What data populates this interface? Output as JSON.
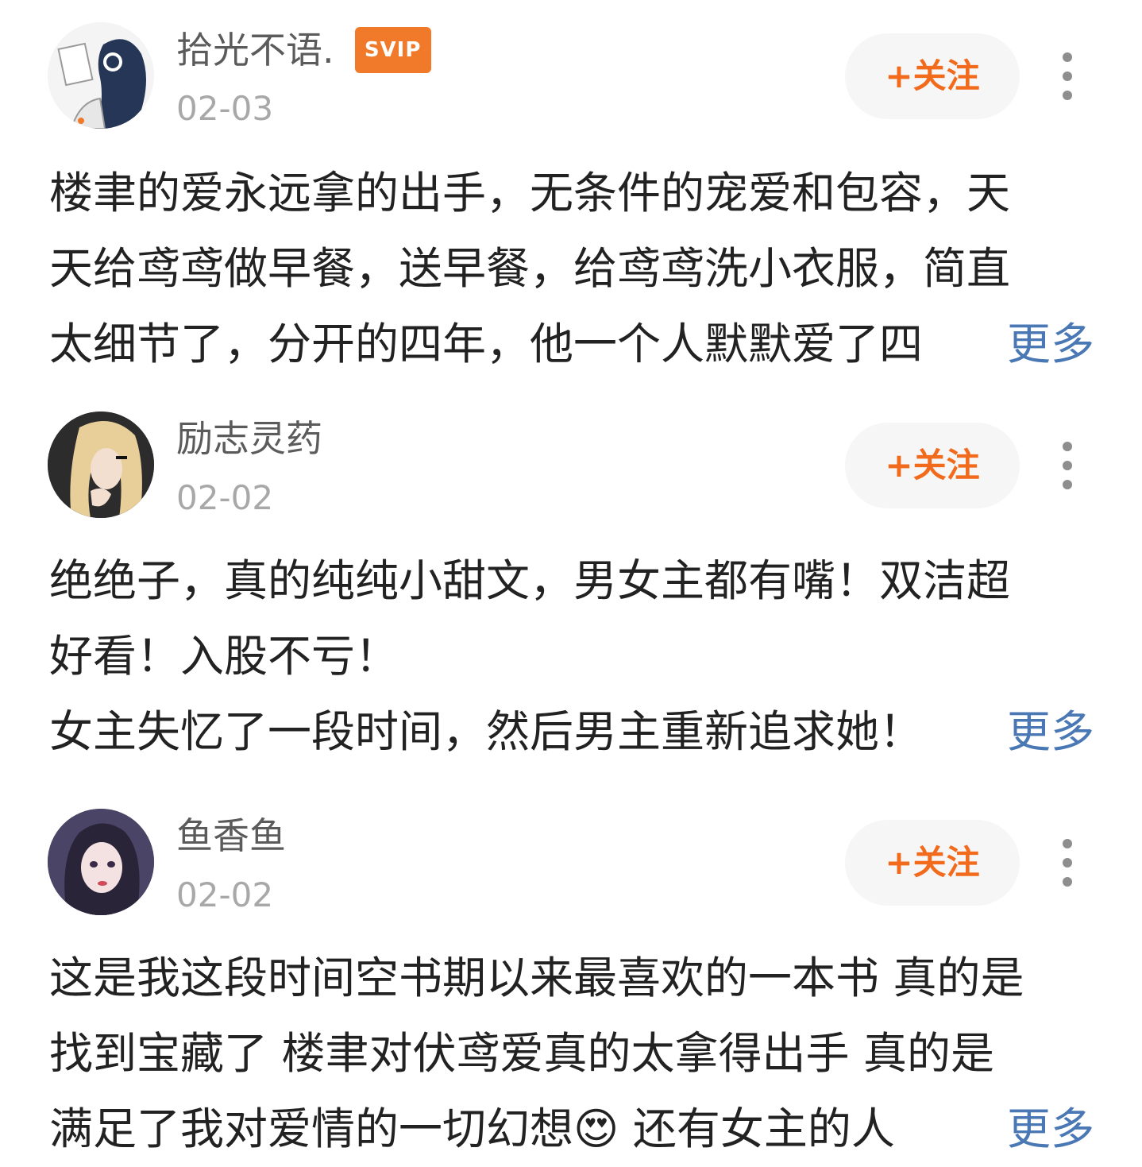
{
  "comments": [
    {
      "username": "拾光不语.",
      "vip_badge": "SVIP",
      "date": "02-03",
      "follow_label": "+关注",
      "lines": [
        "楼聿的爱永远拿的出手，无条件的宠爱和包容，天",
        "天给鸢鸢做早餐，送早餐，给鸢鸢洗小衣服，简直",
        "太细节了，分开的四年，他一个人默默爱了四"
      ],
      "more_label": "更多"
    },
    {
      "username": "励志灵药",
      "date": "02-02",
      "follow_label": "+关注",
      "lines": [
        "绝绝子，真的纯纯小甜文，男女主都有嘴！双洁超",
        "好看！入股不亏！",
        "女主失忆了一段时间，然后男主重新追求她！"
      ],
      "more_label": "更多"
    },
    {
      "username": "鱼香鱼",
      "date": "02-02",
      "follow_label": "+关注",
      "lines": [
        "这是我这段时间空书期以来最喜欢的一本书 真的是",
        "找到宝藏了 楼聿对伏鸢爱真的太拿得出手 真的是",
        "满足了我对爱情的一切幻想😍  还有女主的人"
      ],
      "more_label": "更多"
    }
  ],
  "icons": {
    "avatar_1": "avatar-girl-headphones",
    "avatar_2": "avatar-blonde-girl",
    "avatar_3": "avatar-anime-girl",
    "more": "more-vertical-icon"
  },
  "colors": {
    "follow_text": "#f26a1b",
    "vip_badge": "#f07a2a",
    "more_link": "#4a78b5",
    "date": "#a8a8a8"
  }
}
